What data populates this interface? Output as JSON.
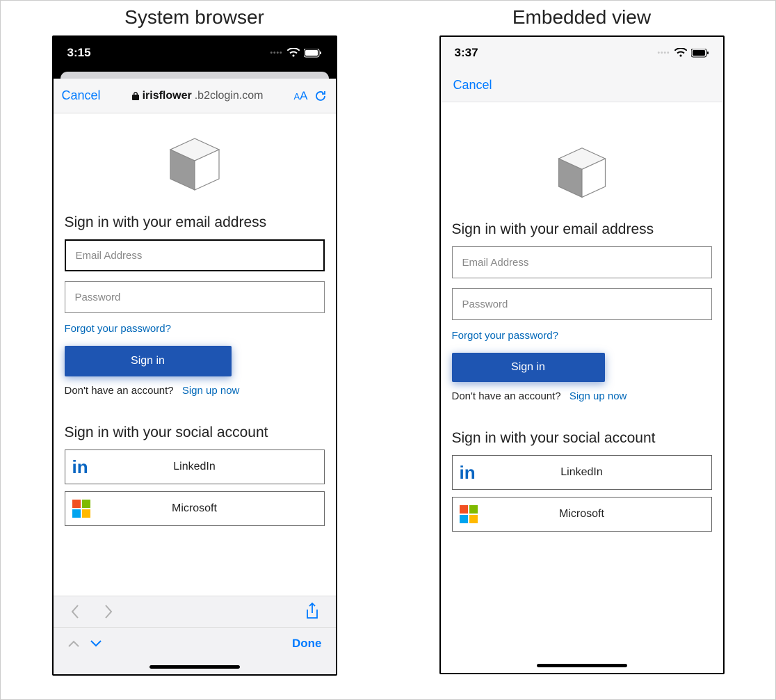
{
  "titles": {
    "left": "System browser",
    "right": "Embedded view"
  },
  "status": {
    "left_time": "3:15",
    "right_time": "3:37"
  },
  "browser": {
    "cancel": "Cancel",
    "domain": "irisflower",
    "path": ".b2clogin.com"
  },
  "embedded": {
    "cancel": "Cancel"
  },
  "signin": {
    "heading": "Sign in with your email address",
    "email_placeholder": "Email Address",
    "password_placeholder": "Password",
    "forgot": "Forgot your password?",
    "button": "Sign in",
    "no_account": "Don't have an account?",
    "signup": "Sign up now"
  },
  "social": {
    "heading": "Sign in with your social account",
    "linkedin": "LinkedIn",
    "microsoft": "Microsoft"
  },
  "footer": {
    "done": "Done"
  }
}
